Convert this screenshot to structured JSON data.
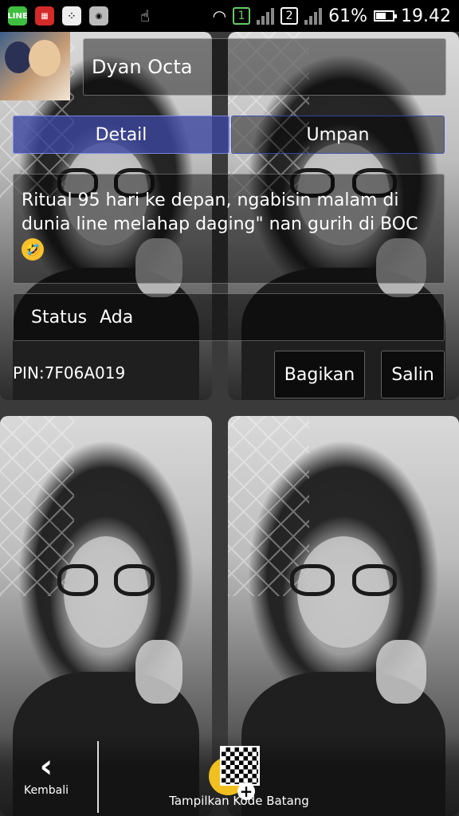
{
  "status_bar": {
    "battery_percent": "61%",
    "time": "19.42",
    "sim1": "1",
    "sim2": "2",
    "battery_level": 0.61,
    "notification_icons": [
      "line-icon",
      "bbm-red-icon",
      "bbm-icon",
      "camera-icon",
      "touch-icon",
      "wifi-icon"
    ],
    "line_label": "LINE"
  },
  "profile": {
    "name": "Dyan Octa",
    "tabs": [
      {
        "label": "Detail",
        "active": true
      },
      {
        "label": "Umpan",
        "active": false
      }
    ],
    "message": "Ritual 95 hari ke depan, ngabisin malam di dunia line melahap daging\" nan gurih di BOC",
    "emoji": "🤣",
    "status_label": "Status",
    "status_value": "Ada",
    "pin": "PIN:7F06A019"
  },
  "actions": {
    "share_label": "Bagikan",
    "copy_label": "Salin"
  },
  "bottom_bar": {
    "back_label": "Kembali",
    "barcode_label": "Tampilkan Kode Batang"
  },
  "colors": {
    "tab_active": "#3c46a0",
    "tab_border": "#3c50c8",
    "coin": "#f0c020"
  }
}
